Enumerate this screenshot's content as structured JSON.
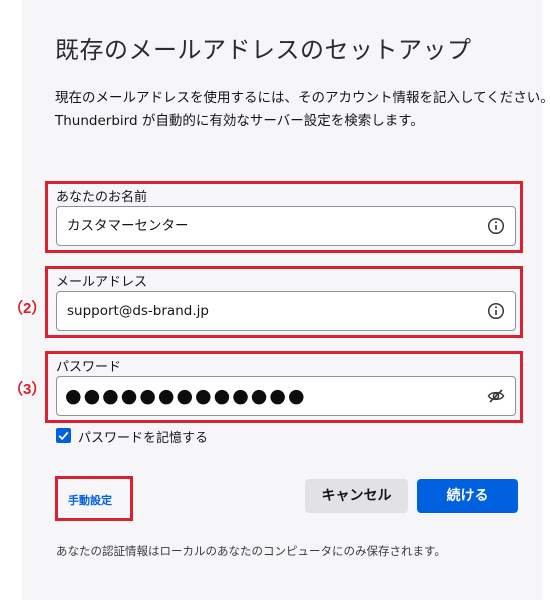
{
  "page": {
    "title": "既存のメールアドレスのセットアップ",
    "description_lines": [
      "現在のメールアドレスを使用するには、そのアカウント情報を記入してください。",
      "Thunderbird が自動的に有効なサーバー設定を検索します。"
    ]
  },
  "fields": {
    "name": {
      "label": "あなたのお名前",
      "value": "カスタマーセンター",
      "icon": "info-icon"
    },
    "email": {
      "label": "メールアドレス",
      "value": "support@ds-brand.jp",
      "icon": "info-icon",
      "marker": "（2）"
    },
    "password": {
      "label": "パスワード",
      "value": "●●●●●●●●●●●●●",
      "icon": "eye-slash-icon",
      "marker": "（3）"
    }
  },
  "remember_password": {
    "label": "パスワードを記憶する",
    "checked": true
  },
  "actions": {
    "manual_config": "手動設定",
    "cancel": "キャンセル",
    "continue": "続ける"
  },
  "footnote": "あなたの認証情報はローカルのあなたのコンピュータにのみ保存されます。",
  "colors": {
    "highlight": "#d9212f",
    "accent": "#0061e0",
    "panel_bg": "#f6f6f8"
  }
}
